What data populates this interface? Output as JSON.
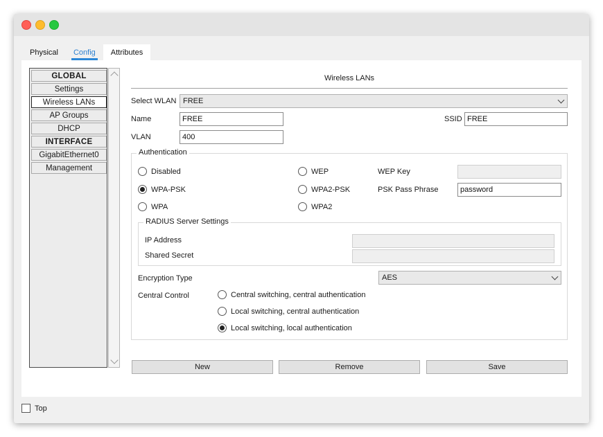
{
  "tabs": [
    {
      "label": "Physical",
      "active": false
    },
    {
      "label": "Config",
      "active": true
    },
    {
      "label": "Attributes",
      "active": false
    }
  ],
  "sidebar": {
    "items": [
      {
        "label": "GLOBAL",
        "type": "header"
      },
      {
        "label": "Settings",
        "type": "item"
      },
      {
        "label": "Wireless LANs",
        "type": "item",
        "selected": true
      },
      {
        "label": "AP Groups",
        "type": "item"
      },
      {
        "label": "DHCP",
        "type": "item"
      },
      {
        "label": "INTERFACE",
        "type": "header"
      },
      {
        "label": "GigabitEthernet0",
        "type": "item"
      },
      {
        "label": "Management",
        "type": "item"
      }
    ]
  },
  "panel": {
    "title": "Wireless LANs",
    "select_wlan_label": "Select WLAN",
    "select_wlan_value": "FREE",
    "name_label": "Name",
    "name_value": "FREE",
    "ssid_label": "SSID",
    "ssid_value": "FREE",
    "vlan_label": "VLAN",
    "vlan_value": "400",
    "authentication": {
      "title": "Authentication",
      "options": [
        {
          "label": "Disabled",
          "checked": false
        },
        {
          "label": "WEP",
          "checked": false
        },
        {
          "label": "WPA-PSK",
          "checked": true
        },
        {
          "label": "WPA2-PSK",
          "checked": false
        },
        {
          "label": "WPA",
          "checked": false
        },
        {
          "label": "WPA2",
          "checked": false
        }
      ],
      "wep_key_label": "WEP Key",
      "wep_key_value": "",
      "psk_label": "PSK Pass Phrase",
      "psk_value": "password",
      "radius": {
        "title": "RADIUS Server Settings",
        "ip_label": "IP Address",
        "ip_value": "",
        "secret_label": "Shared Secret",
        "secret_value": ""
      },
      "encryption_label": "Encryption Type",
      "encryption_value": "AES",
      "central_control_label": "Central Control",
      "central_options": [
        {
          "label": "Central switching, central authentication",
          "checked": false
        },
        {
          "label": "Local switching, central authentication",
          "checked": false
        },
        {
          "label": "Local switching, local authentication",
          "checked": true
        }
      ]
    },
    "buttons": {
      "new": "New",
      "remove": "Remove",
      "save": "Save"
    }
  },
  "footer": {
    "top_label": "Top",
    "top_checked": false
  }
}
